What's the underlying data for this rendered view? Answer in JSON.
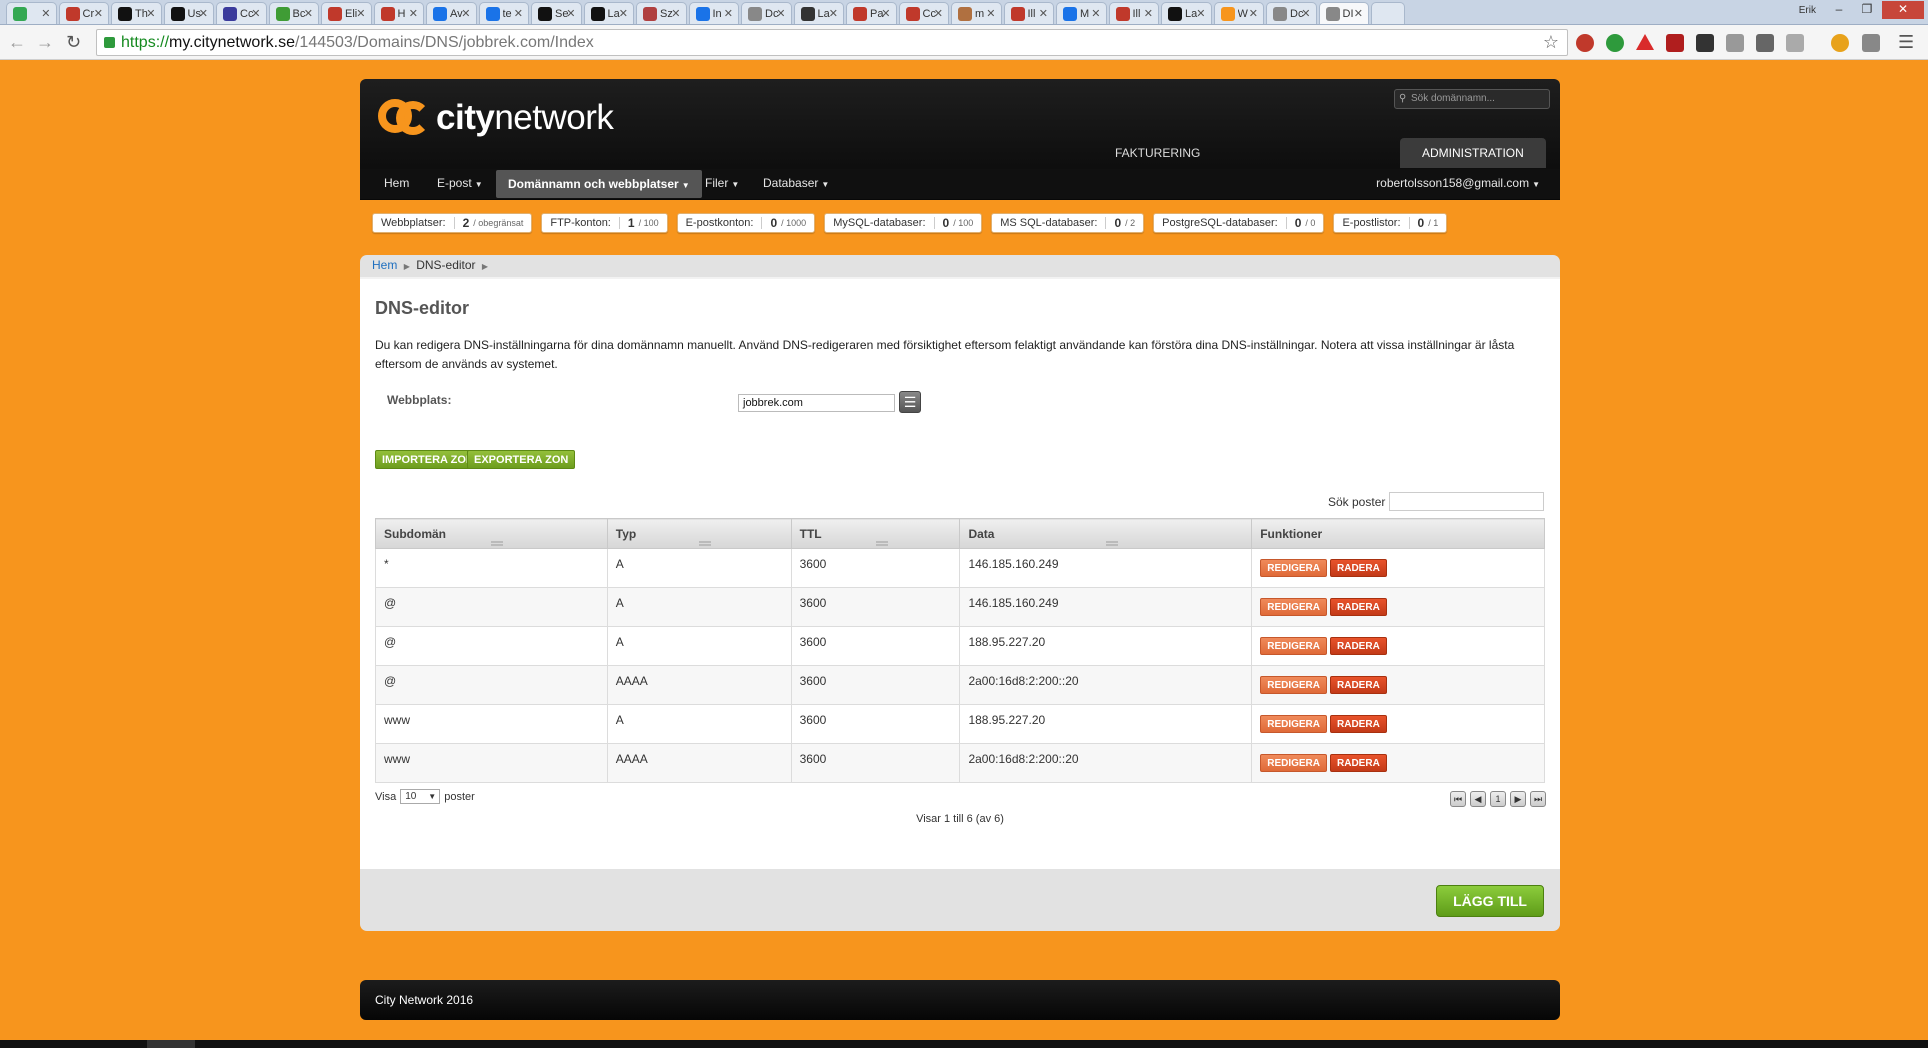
{
  "browser": {
    "url_https": "https://",
    "url_host": "my.citynetwork.se",
    "url_path": "/144503/Domains/DNS/jobbrek.com/Index",
    "user": "Erik",
    "tabs": [
      {
        "label": "",
        "color": "#34a853"
      },
      {
        "label": "Cr",
        "color": "#c0392b"
      },
      {
        "label": "Th",
        "color": "#111111"
      },
      {
        "label": "Us",
        "color": "#111111"
      },
      {
        "label": "Cc",
        "color": "#3b3b9c"
      },
      {
        "label": "Bc",
        "color": "#3f9c35"
      },
      {
        "label": "Eli",
        "color": "#c0392b"
      },
      {
        "label": "H",
        "color": "#c0392b"
      },
      {
        "label": "Av",
        "color": "#1a73e8"
      },
      {
        "label": "te",
        "color": "#1a73e8"
      },
      {
        "label": "Se",
        "color": "#111111"
      },
      {
        "label": "La",
        "color": "#111111"
      },
      {
        "label": "Sz",
        "color": "#b04040"
      },
      {
        "label": "In",
        "color": "#1a73e8"
      },
      {
        "label": "Dc",
        "color": "#888888"
      },
      {
        "label": "La",
        "color": "#333333"
      },
      {
        "label": "Pa",
        "color": "#c0392b"
      },
      {
        "label": "Cc",
        "color": "#c0392b"
      },
      {
        "label": "m",
        "color": "#b07040"
      },
      {
        "label": "Ill",
        "color": "#c0392b"
      },
      {
        "label": "M",
        "color": "#1a73e8"
      },
      {
        "label": "Ill",
        "color": "#c0392b"
      },
      {
        "label": "La",
        "color": "#111111"
      },
      {
        "label": "W",
        "color": "#f7951d"
      },
      {
        "label": "Dc",
        "color": "#888888"
      },
      {
        "label": "DI",
        "color": "#888888"
      }
    ]
  },
  "site": {
    "logo_city": "city",
    "logo_network": "network",
    "search_placeholder": "Sök domännamn...",
    "tab_billing": "FAKTURERING",
    "tab_admin": "ADMINISTRATION",
    "nav": {
      "home": "Hem",
      "email": "E-post",
      "domains": "Domännamn och webbplatser",
      "files": "Filer",
      "databases": "Databaser",
      "account": "robertolsson158@gmail.com"
    },
    "quotas": [
      {
        "label": "Webbplatser:",
        "value": "2",
        "max": "/ obegränsat"
      },
      {
        "label": "FTP-konton:",
        "value": "1",
        "max": "/ 100"
      },
      {
        "label": "E-postkonton:",
        "value": "0",
        "max": "/ 1000"
      },
      {
        "label": "MySQL-databaser:",
        "value": "0",
        "max": "/ 100"
      },
      {
        "label": "MS SQL-databaser:",
        "value": "0",
        "max": "/ 2"
      },
      {
        "label": "PostgreSQL-databaser:",
        "value": "0",
        "max": "/ 0"
      },
      {
        "label": "E-postlistor:",
        "value": "0",
        "max": "/ 1"
      }
    ],
    "breadcrumb_home": "Hem",
    "breadcrumb_current": "DNS-editor",
    "title": "DNS-editor",
    "description": "Du kan redigera DNS-inställningarna för dina domännamn manuellt. Använd DNS-redigeraren med försiktighet eftersom felaktigt användande kan förstöra dina DNS-inställningar. Notera att vissa inställningar är låsta eftersom de används av systemet.",
    "website_label": "Webbplats:",
    "website_value": "jobbrek.com",
    "import_label": "IMPORTERA ZON",
    "export_label": "EXPORTERA ZON",
    "search_label": "Sök poster",
    "columns": [
      "Subdomän",
      "Typ",
      "TTL",
      "Data",
      "Funktioner"
    ],
    "rows": [
      {
        "sub": "*",
        "type": "A",
        "ttl": "3600",
        "data": "146.185.160.249"
      },
      {
        "sub": "@",
        "type": "A",
        "ttl": "3600",
        "data": "146.185.160.249"
      },
      {
        "sub": "@",
        "type": "A",
        "ttl": "3600",
        "data": "188.95.227.20"
      },
      {
        "sub": "@",
        "type": "AAAA",
        "ttl": "3600",
        "data": "2a00:16d8:2:200::20"
      },
      {
        "sub": "www",
        "type": "A",
        "ttl": "3600",
        "data": "188.95.227.20"
      },
      {
        "sub": "www",
        "type": "AAAA",
        "ttl": "3600",
        "data": "2a00:16d8:2:200::20"
      }
    ],
    "edit_label": "REDIGERA",
    "delete_label": "RADERA",
    "show_label": "Visa",
    "show_value": "10",
    "posts_label": "poster",
    "page_number": "1",
    "info_text": "Visar 1 till 6 (av 6)",
    "add_label": "LÄGG TILL",
    "footer": "City Network 2016"
  }
}
